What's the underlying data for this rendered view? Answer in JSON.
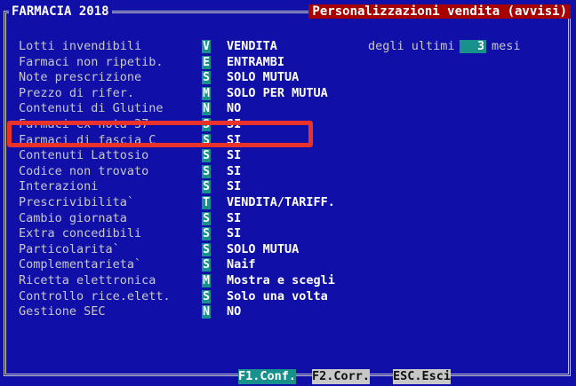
{
  "header": {
    "app_title": "FARMACIA 2018",
    "screen_title": "Personalizzazioni vendita (avvisi)"
  },
  "settings": [
    {
      "label": "Lotti invendibili",
      "code": "V",
      "value": "VENDITA"
    },
    {
      "label": "Farmaci non ripetib.",
      "code": "E",
      "value": "ENTRAMBI"
    },
    {
      "label": "Note prescrizione",
      "code": "S",
      "value": "SOLO MUTUA"
    },
    {
      "label": "Prezzo di rifer.",
      "code": "M",
      "value": "SOLO PER MUTUA"
    },
    {
      "label": "Contenuti di Glutine",
      "code": "N",
      "value": "NO"
    },
    {
      "label": "Farmaci ex nota 37",
      "code": "S",
      "value": "SI"
    },
    {
      "label": "Farmaci di fascia C",
      "code": "S",
      "value": "SI"
    },
    {
      "label": "Contenuti Lattosio",
      "code": "S",
      "value": "SI"
    },
    {
      "label": "Codice non trovato",
      "code": "S",
      "value": "SI"
    },
    {
      "label": "Interazioni",
      "code": "S",
      "value": "SI"
    },
    {
      "label": "Prescrivibilita`",
      "code": "T",
      "value": "VENDITA/TARIFF."
    },
    {
      "label": "Cambio giornata",
      "code": "S",
      "value": "SI"
    },
    {
      "label": "Extra concedibili",
      "code": "S",
      "value": "SI"
    },
    {
      "label": "Particolarita`",
      "code": "S",
      "value": "SOLO MUTUA"
    },
    {
      "label": "Complementarieta`",
      "code": "S",
      "value": "Naif"
    },
    {
      "label": "Ricetta elettronica",
      "code": "M",
      "value": "Mostra e scegli"
    },
    {
      "label": "Controllo rice.elett.",
      "code": "S",
      "value": "Solo una volta"
    },
    {
      "label": "Gestione SEC",
      "code": "N",
      "value": "NO"
    }
  ],
  "lots_period": {
    "prefix": "degli ultimi",
    "months": "3",
    "unit": "mesi"
  },
  "function_keys": {
    "f1": "F1.Conf.",
    "f2": "F2.Corr.",
    "esc": "ESC.Esci"
  },
  "colors": {
    "background": "#1010a8",
    "field_teal": "#18908c",
    "title_red": "#a80000",
    "highlight": "#e8322a"
  }
}
